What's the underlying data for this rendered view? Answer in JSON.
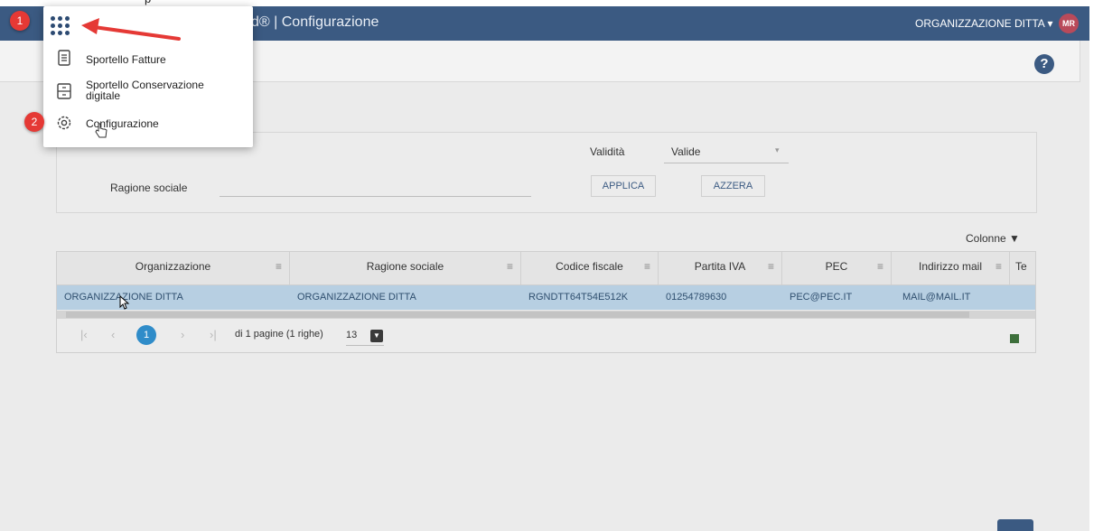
{
  "top_strip_text": "p",
  "appbar": {
    "title": "d® | Configurazione",
    "org_label": "ORGANIZZAZIONE DITTA ▾",
    "avatar": "MR"
  },
  "help_icon": "?",
  "filters": {
    "validita_label": "Validità",
    "validita_value": "Valide",
    "ragione_label": "Ragione sociale",
    "apply_label": "APPLICA",
    "reset_label": "AZZERA"
  },
  "colonne_label": "Colonne ▼",
  "table": {
    "columns": [
      "Organizzazione",
      "Ragione sociale",
      "Codice fiscale",
      "Partita IVA",
      "PEC",
      "Indirizzo mail",
      "Te"
    ],
    "row": [
      "ORGANIZZAZIONE DITTA",
      "ORGANIZZAZIONE DITTA",
      "RGNDTT64T54E512K",
      "01254789630",
      "PEC@PEC.IT",
      "MAIL@MAIL.IT"
    ]
  },
  "pager": {
    "current_page": "1",
    "info": "di 1 pagine (1 righe)",
    "page_size": "13"
  },
  "menu": {
    "items": [
      {
        "label": "Sportello Fatture",
        "icon": "document-icon"
      },
      {
        "label": "Sportello Conservazione digitale",
        "icon": "archive-icon"
      },
      {
        "label": "Configurazione",
        "icon": "gear-icon"
      }
    ]
  },
  "badges": {
    "one": "1",
    "two": "2"
  },
  "colors": {
    "appbar": "#3b5a82",
    "badge": "#e53935",
    "selected_row": "#b7cfe2",
    "page_active": "#2f8cc9"
  }
}
